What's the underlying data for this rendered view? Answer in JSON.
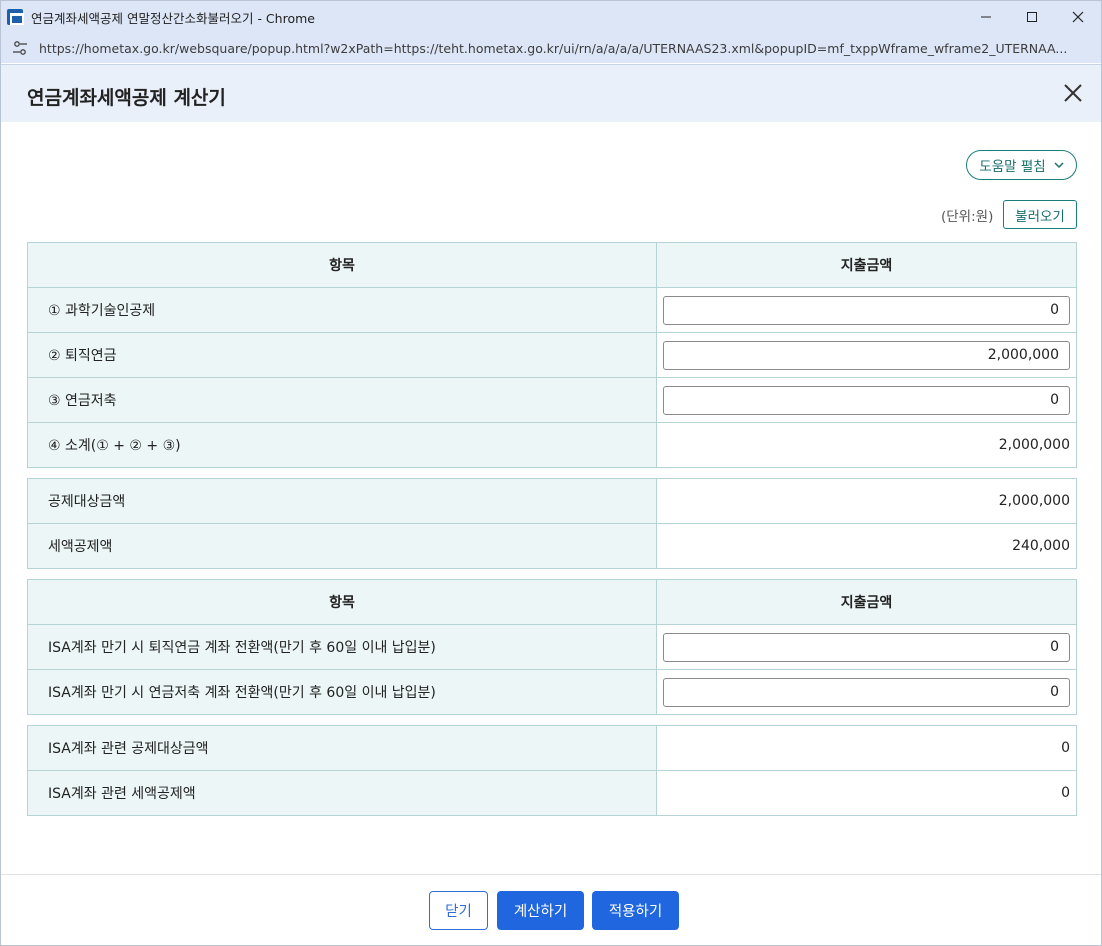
{
  "window": {
    "title": "연금계좌세액공제 연말정산간소화불러오기 - Chrome",
    "url": "https://hometax.go.kr/websquare/popup.html?w2xPath=https://teht.hometax.go.kr/ui/rn/a/a/a/a/UTERNAAS23.xml&popupID=mf_txppWframe_wframe2_UTERNAA..."
  },
  "dialog": {
    "title": "연금계좌세액공제 계산기",
    "help_label": "도움말 펼침",
    "unit_label": "(단위:원)",
    "load_label": "불러오기"
  },
  "table1": {
    "headers": [
      "항목",
      "지출금액"
    ],
    "rows": [
      {
        "label": "① 과학기술인공제",
        "value": "0"
      },
      {
        "label": "② 퇴직연금",
        "value": "2,000,000"
      },
      {
        "label": "③ 연금저축",
        "value": "0"
      },
      {
        "label": "④ 소계(① + ② + ③)",
        "value": "2,000,000"
      }
    ]
  },
  "summary1": {
    "rows": [
      {
        "label": "공제대상금액",
        "value": "2,000,000"
      },
      {
        "label": "세액공제액",
        "value": "240,000"
      }
    ]
  },
  "table2": {
    "headers": [
      "항목",
      "지출금액"
    ],
    "rows": [
      {
        "label": "ISA계좌 만기 시 퇴직연금 계좌 전환액(만기 후 60일 이내 납입분)",
        "value": "0"
      },
      {
        "label": "ISA계좌 만기 시 연금저축 계좌 전환액(만기 후 60일 이내 납입분)",
        "value": "0"
      }
    ]
  },
  "summary2": {
    "rows": [
      {
        "label": "ISA계좌 관련 공제대상금액",
        "value": "0"
      },
      {
        "label": "ISA계좌 관련 세액공제액",
        "value": "0"
      }
    ]
  },
  "footer": {
    "close_label": "닫기",
    "calc_label": "계산하기",
    "apply_label": "적용하기"
  },
  "colors": {
    "accent_teal": "#1a7f7b",
    "primary_blue": "#1f66df",
    "header_bg": "#eaf0fa",
    "table_label_bg": "#ecf6f6"
  }
}
